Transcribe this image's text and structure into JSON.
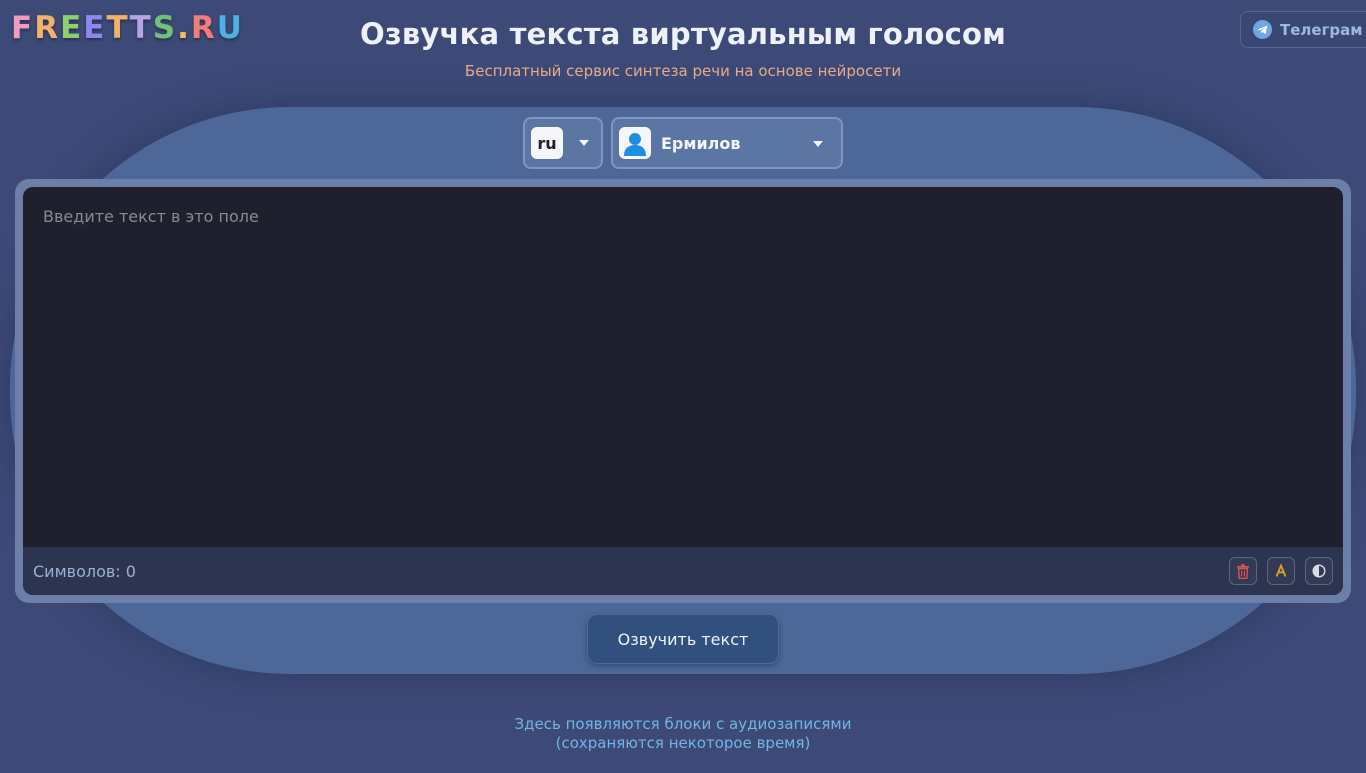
{
  "logo": {
    "letters": [
      {
        "ch": "F",
        "color": "#f39ac3"
      },
      {
        "ch": "R",
        "color": "#f4b16a"
      },
      {
        "ch": "E",
        "color": "#8ed06e"
      },
      {
        "ch": "E",
        "color": "#8f87f0"
      },
      {
        "ch": "T",
        "color": "#f4b16a"
      },
      {
        "ch": "T",
        "color": "#b3a6e6"
      },
      {
        "ch": "S",
        "color": "#6fc17a"
      },
      {
        "ch": ".",
        "color": "#f1c35a"
      },
      {
        "ch": "R",
        "color": "#f57b7b"
      },
      {
        "ch": "U",
        "color": "#4fb0e6"
      }
    ]
  },
  "header": {
    "telegram_label": "Телеграм",
    "title": "Озвучка текста виртуальным голосом",
    "subtitle": "Бесплатный сервис синтеза речи на основе нейросети"
  },
  "controls": {
    "language": "ru",
    "voice": "Ермилов"
  },
  "editor": {
    "placeholder": "Введите текст в это поле",
    "counter": "Символов: 0"
  },
  "actions": {
    "speak_label": "Озвучить текст"
  },
  "audio": {
    "hint_line1": "Здесь появляются блоки с аудиозаписями",
    "hint_line2": "(сохраняются некоторое время)"
  },
  "colors": {
    "background": "#3d4a78",
    "panel": "#4d6898",
    "editor": "#1f1f2e",
    "subtitle": "#e9ad8c",
    "hint": "#72b4e2",
    "delete_icon": "#d9534f",
    "format_icon": "#e0a020"
  }
}
